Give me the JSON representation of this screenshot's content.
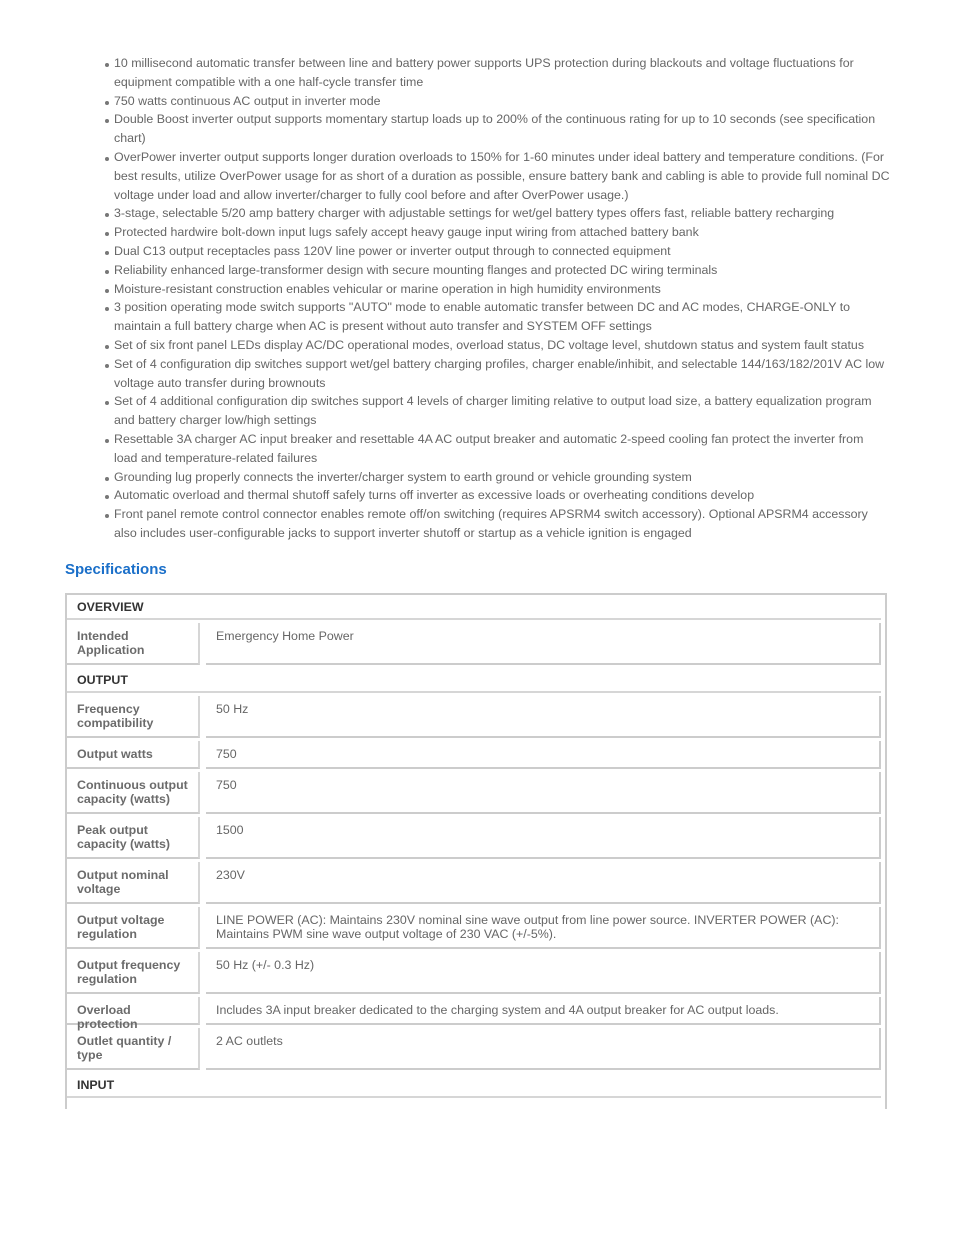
{
  "features": [
    "10 millisecond automatic transfer between line and battery power supports UPS protection during blackouts and voltage fluctuations for equipment compatible with a one half-cycle transfer time",
    "750 watts continuous AC output in inverter mode",
    "Double Boost inverter output supports momentary startup loads up to 200% of the continuous rating for up to 10 seconds (see specification chart)",
    "OverPower inverter output supports longer duration overloads to 150% for 1-60 minutes under ideal battery and temperature conditions. (For best results, utilize OverPower usage for as short of a duration as possible, ensure battery bank and cabling is able to provide full nominal DC voltage under load and allow inverter/charger to fully cool before and after OverPower usage.)",
    "3-stage, selectable 5/20 amp battery charger with adjustable settings for wet/gel battery types offers fast, reliable battery recharging",
    "Protected hardwire bolt-down input lugs safely accept heavy gauge input wiring from attached battery bank",
    "Dual C13 output receptacles pass 120V line power or inverter output through to connected equipment",
    "Reliability enhanced large-transformer design with secure mounting flanges and protected DC wiring terminals",
    "Moisture-resistant construction enables vehicular or marine operation in high humidity environments",
    "3 position operating mode switch supports \"AUTO\" mode to enable automatic transfer between DC and AC modes, CHARGE-ONLY to maintain a full battery charge when AC is present without auto transfer and SYSTEM OFF settings",
    "Set of six front panel LEDs display AC/DC operational modes, overload status, DC voltage level, shutdown status and system fault status",
    "Set of 4 configuration dip switches support wet/gel battery charging profiles, charger enable/inhibit, and selectable 144/163/182/201V AC low voltage auto transfer during brownouts",
    "Set of 4 additional configuration dip switches support 4 levels of charger limiting relative to output load size, a battery equalization program and battery charger low/high settings",
    "Resettable 3A charger AC input breaker and resettable 4A AC output breaker and automatic 2-speed cooling fan protect the inverter from load and temperature-related failures",
    "Grounding lug properly connects the inverter/charger system to earth ground or vehicle grounding system",
    "Automatic overload and thermal shutoff safely turns off inverter as excessive loads or overheating conditions develop",
    "Front panel remote control connector enables remote off/on switching (requires APSRM4 switch accessory). Optional APSRM4 accessory also includes user-configurable jacks to support inverter shutoff or startup as a vehicle ignition is engaged"
  ],
  "specs": {
    "heading": "Specifications",
    "heading_color": "#1a6fc9",
    "sections": [
      {
        "title": "OVERVIEW",
        "rows": [
          {
            "label": "Intended Application",
            "value": "Emergency Home Power"
          }
        ]
      },
      {
        "title": "OUTPUT",
        "rows": [
          {
            "label": "Frequency compatibility",
            "value": "50 Hz"
          },
          {
            "label": "Output watts",
            "value": "750"
          },
          {
            "label": "Continuous output capacity (watts)",
            "value": "750"
          },
          {
            "label": "Peak output capacity (watts)",
            "value": "1500"
          },
          {
            "label": "Output nominal voltage",
            "value": "230V"
          },
          {
            "label": "Output voltage regulation",
            "value": "LINE POWER (AC): Maintains 230V nominal sine wave output from line power source. INVERTER POWER (AC): Maintains PWM sine wave output voltage of 230 VAC (+/-5%)."
          },
          {
            "label": "Output frequency regulation",
            "value": "50 Hz (+/- 0.3 Hz)"
          },
          {
            "label": "Overload protection",
            "value": "Includes 3A input breaker dedicated to the charging system and 4A output breaker for AC output loads."
          },
          {
            "label": "Outlet quantity / type",
            "value": "2 AC outlets"
          }
        ]
      },
      {
        "title": "INPUT",
        "rows": []
      }
    ]
  }
}
